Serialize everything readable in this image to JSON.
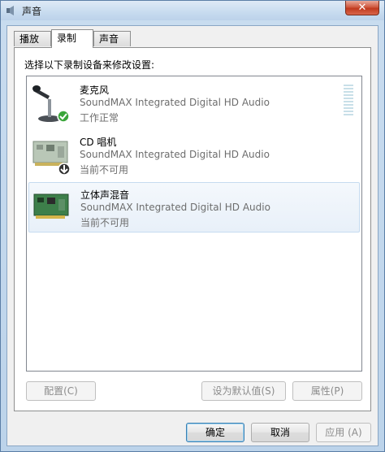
{
  "window": {
    "title": "声音",
    "close_glyph": "✕"
  },
  "tabs": [
    {
      "label": "播放"
    },
    {
      "label": "录制"
    },
    {
      "label": "声音"
    }
  ],
  "panel": {
    "instruction": "选择以下录制设备来修改设置:"
  },
  "devices": [
    {
      "name": "麦克风",
      "driver": "SoundMAX Integrated Digital HD Audio",
      "status": "工作正常",
      "icon": "microphone-icon",
      "badge": "check-badge-icon"
    },
    {
      "name": "CD 唱机",
      "driver": "SoundMAX Integrated Digital HD Audio",
      "status": "当前不可用",
      "icon": "sound-card-icon",
      "badge": "down-arrow-badge-icon"
    },
    {
      "name": "立体声混音",
      "driver": "SoundMAX Integrated Digital HD Audio",
      "status": "当前不可用",
      "icon": "sound-card-icon"
    }
  ],
  "panel_buttons": {
    "configure": "配置(C)",
    "set_default": "设为默认值(S)",
    "properties": "属性(P)"
  },
  "dialog_buttons": {
    "ok": "确定",
    "cancel": "取消",
    "apply": "应用 (A)"
  }
}
